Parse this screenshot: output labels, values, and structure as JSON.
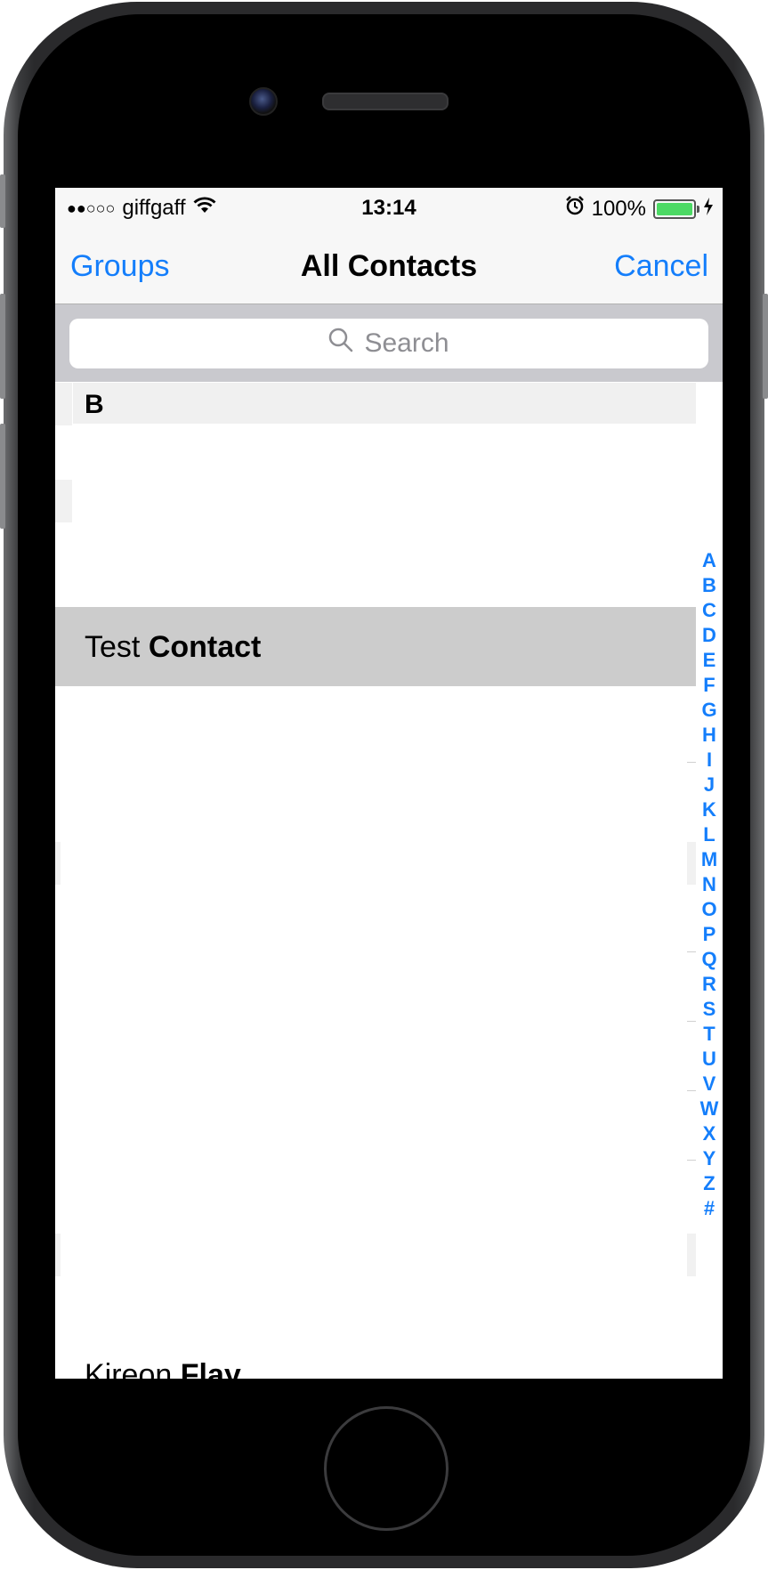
{
  "status_bar": {
    "signal_dots": "●●○○○",
    "carrier": "giffgaff",
    "wifi_icon": "wifi-icon",
    "time": "13:14",
    "alarm_icon": "alarm-icon",
    "battery_percent": "100%",
    "battery_level": 1.0,
    "charging_icon": "bolt-icon"
  },
  "nav": {
    "left": "Groups",
    "title": "All Contacts",
    "right": "Cancel"
  },
  "search": {
    "placeholder": "Search"
  },
  "section": {
    "letter": "B"
  },
  "selected_contact": {
    "first": "Test",
    "last": "Contact"
  },
  "partial_contact": {
    "first": "Kireon",
    "last": "Flay"
  },
  "index_letters": [
    "A",
    "B",
    "C",
    "D",
    "E",
    "F",
    "G",
    "H",
    "I",
    "J",
    "K",
    "L",
    "M",
    "N",
    "O",
    "P",
    "Q",
    "R",
    "S",
    "T",
    "U",
    "V",
    "W",
    "X",
    "Y",
    "Z",
    "#"
  ],
  "colors": {
    "tint": "#147efb",
    "selected_row": "#cccccc",
    "search_bar_bg": "#c9c9ce"
  }
}
